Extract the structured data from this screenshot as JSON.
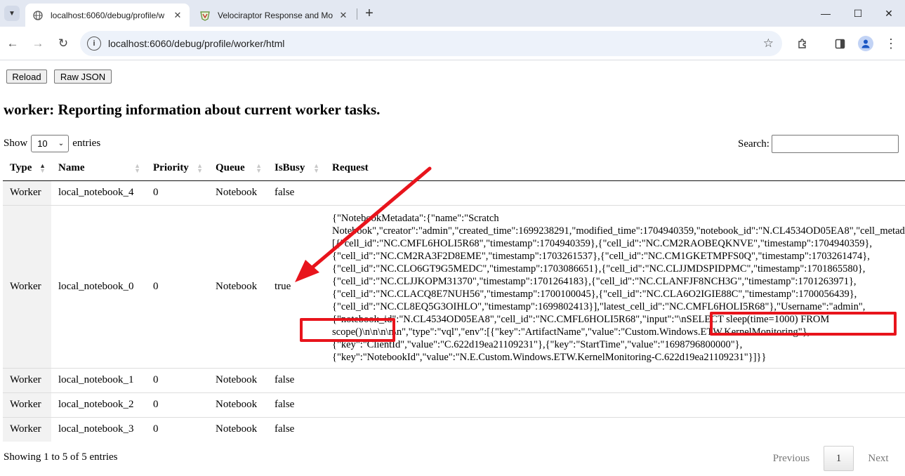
{
  "browser": {
    "tabs": [
      {
        "title": "localhost:6060/debug/profile/w",
        "active": true
      },
      {
        "title": "Velociraptor Response and Mon",
        "active": false
      }
    ],
    "url": "localhost:6060/debug/profile/worker/html"
  },
  "page": {
    "buttons": {
      "reload": "Reload",
      "raw_json": "Raw JSON"
    },
    "title": "worker: Reporting information about current worker tasks.",
    "length": {
      "show": "Show",
      "value": "10",
      "entries": "entries"
    },
    "search_label": "Search:",
    "columns": [
      "Type",
      "Name",
      "Priority",
      "Queue",
      "IsBusy",
      "Request"
    ],
    "rows": [
      {
        "type": "Worker",
        "name": "local_notebook_4",
        "priority": "0",
        "queue": "Notebook",
        "busy": "false",
        "request": ""
      },
      {
        "type": "Worker",
        "name": "local_notebook_0",
        "priority": "0",
        "queue": "Notebook",
        "busy": "true",
        "request": "{\"NotebookMetadata\":{\"name\":\"Scratch Notebook\",\"creator\":\"admin\",\"created_time\":1699238291,\"modified_time\":1704940359,\"notebook_id\":\"N.CL4534OD05EA8\",\"cell_metadata\": [{\"cell_id\":\"NC.CMFL6HOLI5R68\",\"timestamp\":1704940359},{\"cell_id\":\"NC.CM2RAOBEQKNVE\",\"timestamp\":1704940359}, {\"cell_id\":\"NC.CM2RA3F2D8EME\",\"timestamp\":1703261537},{\"cell_id\":\"NC.CM1GKETMPFS0Q\",\"timestamp\":1703261474}, {\"cell_id\":\"NC.CLO6GT9G5MEDC\",\"timestamp\":1703086651},{\"cell_id\":\"NC.CLJJMDSPIDPMC\",\"timestamp\":1701865580}, {\"cell_id\":\"NC.CLJJKOPM31370\",\"timestamp\":1701264183},{\"cell_id\":\"NC.CLANFJF8NCH3G\",\"timestamp\":1701263971}, {\"cell_id\":\"NC.CLACQ8E7NUH56\",\"timestamp\":1700100045},{\"cell_id\":\"NC.CLA6O2IGIE88C\",\"timestamp\":1700056439}, {\"cell_id\":\"NC.CL8EQ5G3OIHLO\",\"timestamp\":1699802413}],\"latest_cell_id\":\"NC.CMFL6HOLI5R68\"},\"Username\":\"admin\", {\"notebook_id\":\"N.CL4534OD05EA8\",\"cell_id\":\"NC.CMFL6HOLI5R68\",\"input\":\"\\nSELECT sleep(time=1000) FROM scope()\\n\\n\\n\\n\\n\",\"type\":\"vql\",\"env\":[{\"key\":\"ArtifactName\",\"value\":\"Custom.Windows.ETW.KernelMonitoring\"}, {\"key\":\"ClientId\",\"value\":\"C.622d19ea21109231\"},{\"key\":\"StartTime\",\"value\":\"1698796800000\"}, {\"key\":\"NotebookId\",\"value\":\"N.E.Custom.Windows.ETW.KernelMonitoring-C.622d19ea21109231\"}]}}"
      },
      {
        "type": "Worker",
        "name": "local_notebook_1",
        "priority": "0",
        "queue": "Notebook",
        "busy": "false",
        "request": ""
      },
      {
        "type": "Worker",
        "name": "local_notebook_2",
        "priority": "0",
        "queue": "Notebook",
        "busy": "false",
        "request": ""
      },
      {
        "type": "Worker",
        "name": "local_notebook_3",
        "priority": "0",
        "queue": "Notebook",
        "busy": "false",
        "request": ""
      }
    ],
    "info": "Showing 1 to 5 of 5 entries",
    "pager": {
      "previous": "Previous",
      "current": "1",
      "next": "Next"
    }
  },
  "colors": {
    "annotation": "#e8141c",
    "tabbar": "#e3e8f2",
    "omnibox": "#edf2fa"
  },
  "icons": [
    "tab-search-icon",
    "globe-icon",
    "velociraptor-icon",
    "close-icon",
    "plus-icon",
    "minimize-icon",
    "maximize-icon",
    "back-icon",
    "forward-icon",
    "reload-icon",
    "site-info-icon",
    "star-icon",
    "extensions-icon",
    "side-panel-icon",
    "profile-icon",
    "kebab-menu-icon"
  ]
}
